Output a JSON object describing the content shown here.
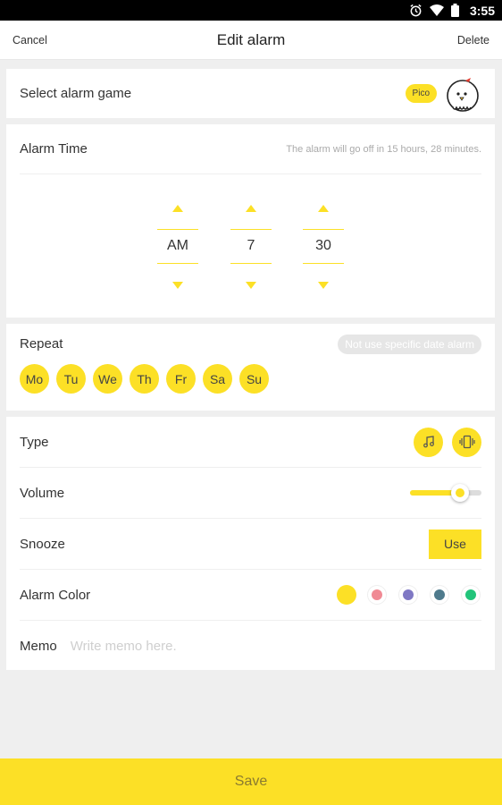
{
  "status_bar": {
    "time": "3:55"
  },
  "header": {
    "cancel": "Cancel",
    "title": "Edit alarm",
    "delete": "Delete"
  },
  "game": {
    "label": "Select alarm game",
    "badge": "Pico",
    "avatar_icon": "pico-character-icon"
  },
  "alarm_time": {
    "label": "Alarm Time",
    "hint": "The alarm will go off in 15 hours, 28 minutes.",
    "ampm": "AM",
    "hour": "7",
    "minute": "30"
  },
  "repeat": {
    "label": "Repeat",
    "date_pill": "Not use specific date alarm",
    "days": [
      "Mo",
      "Tu",
      "We",
      "Th",
      "Fr",
      "Sa",
      "Su"
    ]
  },
  "type": {
    "label": "Type",
    "icons": [
      "music-note-icon",
      "vibrate-icon"
    ]
  },
  "volume": {
    "label": "Volume",
    "level": 0.7
  },
  "snooze": {
    "label": "Snooze",
    "button": "Use"
  },
  "alarm_color": {
    "label": "Alarm Color",
    "colors": [
      "#fce026",
      "#f08a94",
      "#7f78c4",
      "#4e7a8c",
      "#22c47a"
    ],
    "selected": 0
  },
  "memo": {
    "label": "Memo",
    "placeholder": "Write memo here."
  },
  "save": {
    "label": "Save"
  },
  "colors": {
    "accent": "#fce026"
  }
}
